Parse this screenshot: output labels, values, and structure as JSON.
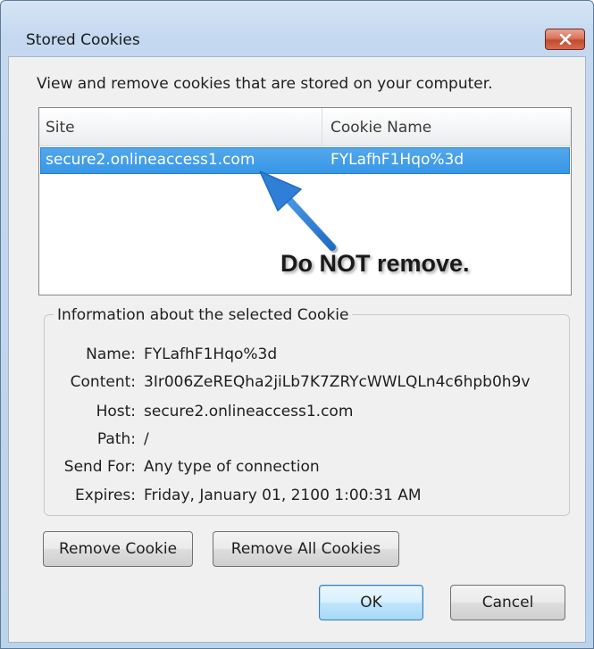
{
  "window": {
    "title": "Stored Cookies",
    "close_icon": "close-icon"
  },
  "description": "View and remove cookies that are stored on your computer.",
  "tree": {
    "columns": [
      "Site",
      "Cookie Name"
    ],
    "rows": [
      {
        "site": "secure2.onlineaccess1.com",
        "cookie_name": "FYLafhF1Hqo%3d",
        "selected": true
      }
    ]
  },
  "annotation": {
    "text": "Do NOT remove.",
    "arrow_color": "#2f7fd6"
  },
  "info": {
    "legend": "Information about the selected Cookie",
    "name_label": "Name:",
    "name_value": "FYLafhF1Hqo%3d",
    "content_label": "Content:",
    "content_value": "3Ir006ZeREQha2jiLb7K7ZRYcWWLQLn4c6hpb0h9v",
    "host_label": "Host:",
    "host_value": "secure2.onlineaccess1.com",
    "path_label": "Path:",
    "path_value": "/",
    "send_for_label": "Send For:",
    "send_for_value": "Any type of connection",
    "expires_label": "Expires:",
    "expires_value": "Friday, January 01, 2100 1:00:31 AM"
  },
  "buttons": {
    "remove_cookie": "Remove Cookie",
    "remove_all": "Remove All Cookies",
    "ok": "OK",
    "cancel": "Cancel"
  },
  "colors": {
    "selection": "#3797e6",
    "close_button": "#c44a2f",
    "window_frame": "#c4d8ef"
  }
}
